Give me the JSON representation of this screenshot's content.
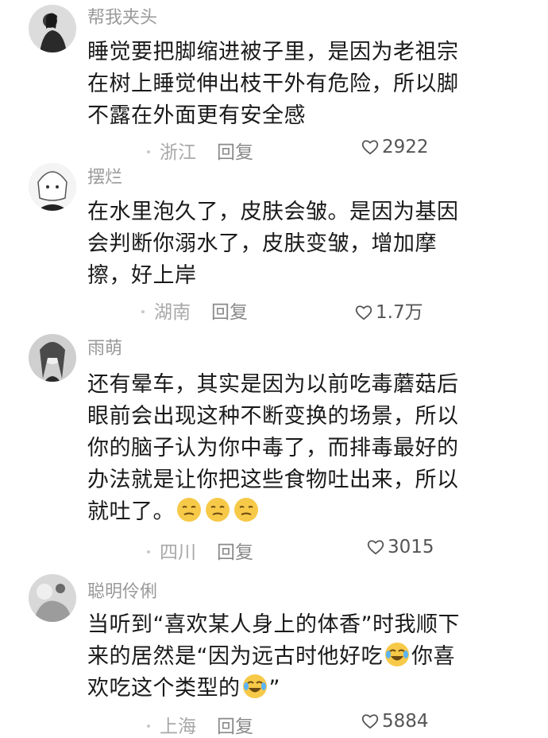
{
  "comments": [
    {
      "username": "帮我夹头",
      "lines": [
        "睡觉要把脚缩进被子里，是因为老祖宗",
        "在树上睡觉伸出枝干外有危险，所以脚",
        "不露在外面更有安全感"
      ],
      "location": "浙江",
      "reply_label": "回复",
      "likes": "2922"
    },
    {
      "username": "摆烂",
      "lines": [
        "在水里泡久了，皮肤会皱。是因为基因",
        "会判断你溺水了，皮肤变皱，增加摩",
        "擦，好上岸"
      ],
      "location": "湖南",
      "reply_label": "回复",
      "likes": "1.7万"
    },
    {
      "username": "雨萌",
      "lines": [
        "还有晕车，其实是因为以前吃毒蘑菇后",
        "眼前会出现这种不断变换的场景，所以",
        "你的脑子认为你中毒了，而排毒最好的",
        "办法就是让你把这些食物吐出来，所以",
        "就吐了。"
      ],
      "emoji_after_last_line": [
        "smirk-emoji",
        "smirk-emoji",
        "smirk-emoji"
      ],
      "location": "四川",
      "reply_label": "回复",
      "likes": "3015"
    },
    {
      "username": "聪明伶俐",
      "lines": [
        "当听到“喜欢某人身上的体香”时我顺下",
        "来的居然是“因为远古时他好吃",
        "欢吃这个类型的"
      ],
      "line2_tail": "你喜",
      "line3_tail": "”",
      "emoji_line2": "laugh-cry-emoji",
      "emoji_line3": "laugh-cry-emoji",
      "location": "上海",
      "reply_label": "回复",
      "likes": "5884"
    }
  ],
  "colors": {
    "username": "#9a9a9a",
    "text": "#1a1a1a",
    "meta": "#a8a8a8",
    "emoji": "#f7c948"
  }
}
